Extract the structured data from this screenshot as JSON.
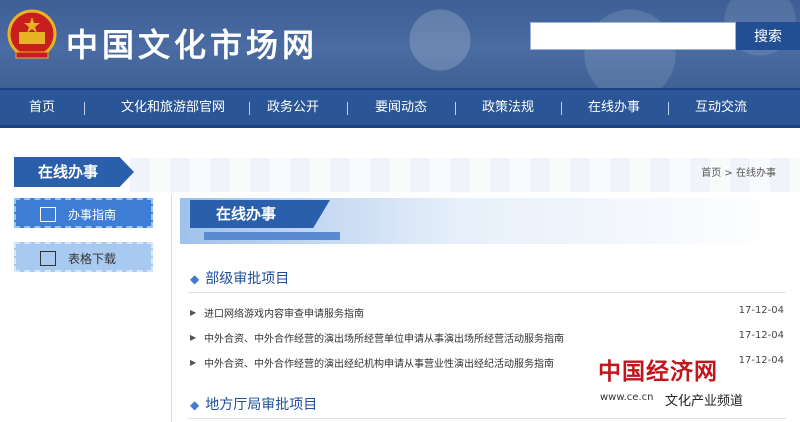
{
  "header": {
    "site_title": "中国文化市场网",
    "search_placeholder": "",
    "search_button": "搜索"
  },
  "nav": [
    "首页",
    "文化和旅游部官网",
    "政务公开",
    "要闻动态",
    "政策法规",
    "在线办事",
    "互动交流"
  ],
  "breadcrumb": "首页 > 在线办事",
  "section_title": "在线办事",
  "sidebar": [
    {
      "label": "办事指南",
      "icon": "edit-icon",
      "active": true
    },
    {
      "label": "表格下载",
      "icon": "list-icon",
      "active": false
    }
  ],
  "main_title": "在线办事",
  "categories": [
    {
      "title": "部级审批项目",
      "items": [
        {
          "title": "进口网络游戏内容审查申请服务指南",
          "date": "17-12-04"
        },
        {
          "title": "中外合资、中外合作经营的演出场所经营单位申请从事演出场所经营活动服务指南",
          "date": "17-12-04"
        },
        {
          "title": "中外合资、中外合作经营的演出经纪机构申请从事营业性演出经纪活动服务指南",
          "date": "17-12-04"
        }
      ]
    },
    {
      "title": "地方厅局审批项目",
      "items": []
    }
  ],
  "watermark": {
    "logo": "中国经济网",
    "url": "www.ce.cn",
    "sub": "文化产业频道"
  },
  "colors": {
    "header_bg": "#4a6ca2",
    "nav_bg": "#2a5596",
    "accent": "#2a5fab",
    "sidebar_active": "#3e7dd6",
    "sidebar_inactive": "#a9caf0",
    "category_title": "#1f4e9a",
    "watermark_red": "#c0161c"
  }
}
